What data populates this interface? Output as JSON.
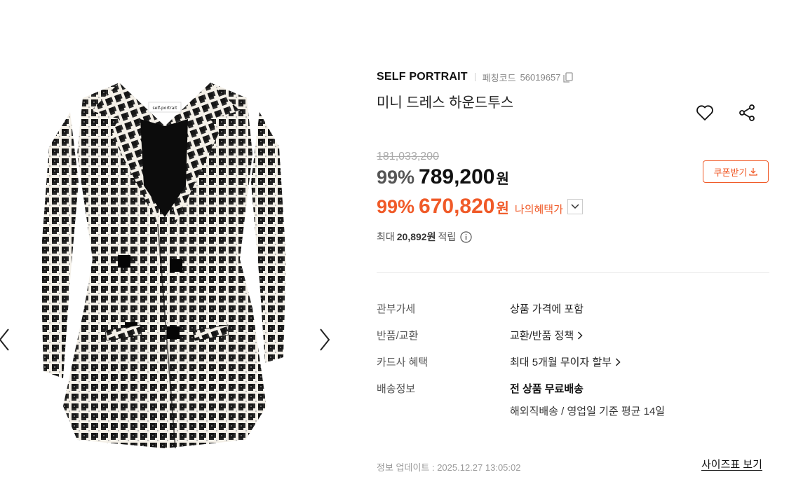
{
  "product": {
    "brand": "SELF PORTRAIT",
    "code_label": "페칭코드",
    "code_value": "56019657",
    "title": "미니 드레스 하운드투스",
    "label_text": "self-portrait"
  },
  "pricing": {
    "original_price": "181,033,200",
    "discount_percent": "99%",
    "sale_price": "789,200",
    "currency": "원",
    "benefit_percent": "99%",
    "benefit_price": "670,820",
    "benefit_label": "나의혜택가",
    "coupon_label": "쿠폰받기",
    "points_prefix": "최대",
    "points_amount": "20,892원",
    "points_suffix": "적립"
  },
  "details": [
    {
      "label": "관부가세",
      "value": "상품 가격에 포함"
    },
    {
      "label": "반품/교환",
      "value": "교환/반품 정책"
    },
    {
      "label": "카드사 혜택",
      "value": "최대 5개월 무이자 할부"
    },
    {
      "label": "배송정보",
      "value": "전 상품 무료배송",
      "sub": "해외직배송 / 영업일 기준 평균 14일"
    }
  ],
  "footer": {
    "updated": "정보 업데이트 : 2025.12.27 13:05:02",
    "size_guide": "사이즈표 보기"
  },
  "icons": {
    "copy": "copy-icon",
    "wishlist": "heart-icon",
    "share": "share-icon",
    "download": "download-icon",
    "dropdown": "chevron-down-icon",
    "info": "info-icon",
    "prev": "chevron-left-icon",
    "next": "chevron-right-icon"
  },
  "colors": {
    "accent": "#f05a28",
    "text": "#111111",
    "muted": "#888888"
  }
}
